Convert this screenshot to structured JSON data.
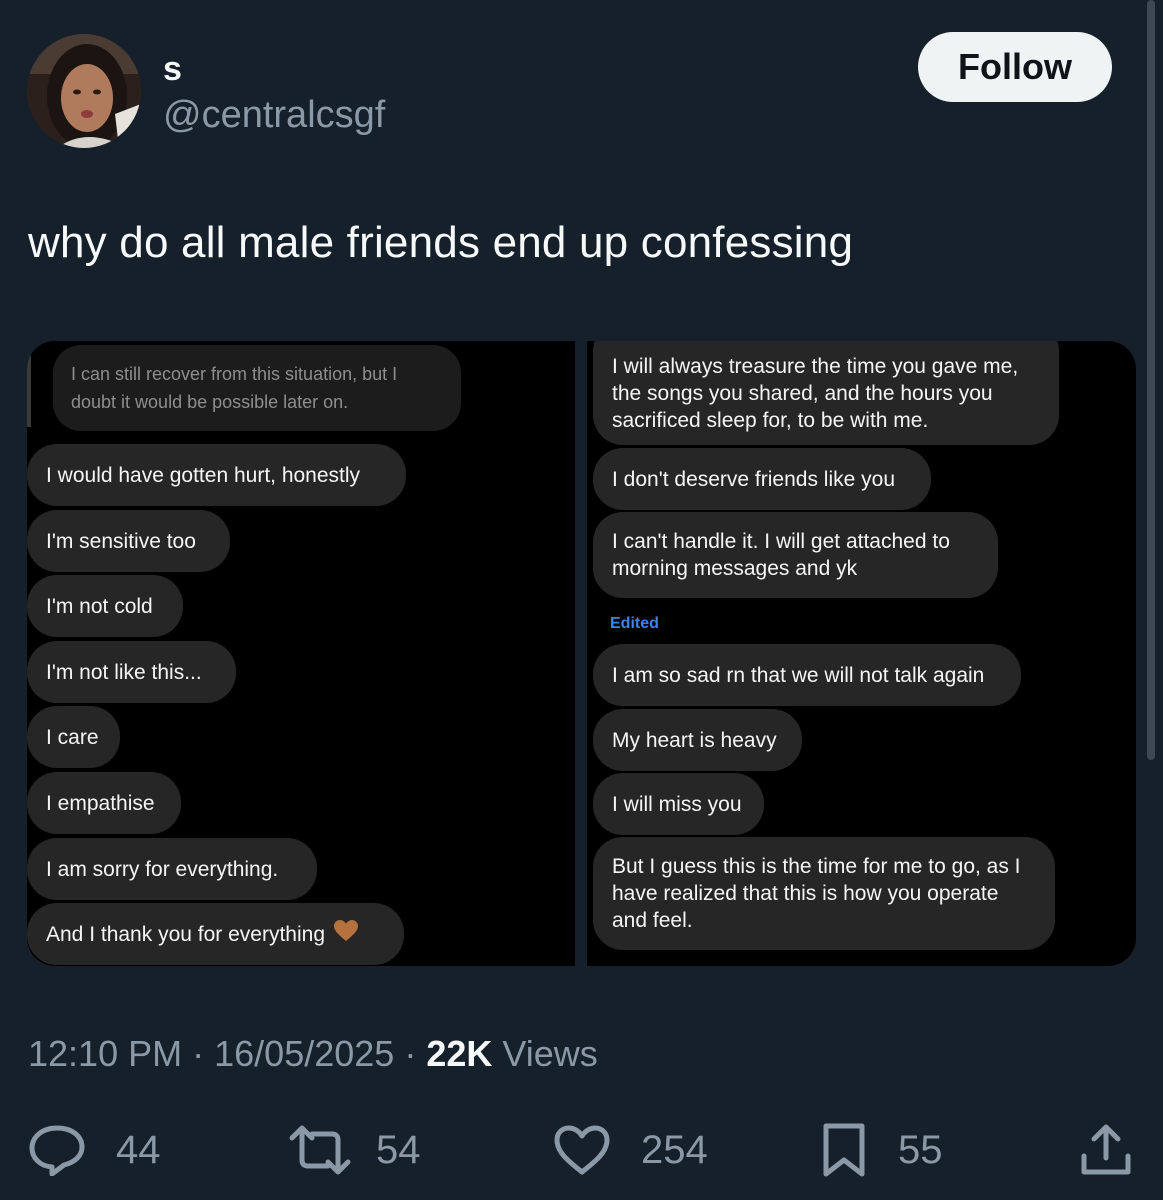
{
  "author": {
    "display_name": "s",
    "handle": "@centralcsgf"
  },
  "follow_label": "Follow",
  "tweet_text": "why do all male friends end up confessing",
  "media": {
    "left_panel": {
      "reply_quote": "I can still recover from this situation, but I doubt it would be possible later on.",
      "messages": [
        "I would have gotten hurt, honestly",
        "I'm sensitive too",
        "I'm not cold",
        "I'm not like this...",
        "I care",
        "I empathise",
        "I am sorry for everything.",
        "And I thank you for everything"
      ],
      "last_emoji": "brown-heart-icon"
    },
    "right_panel": {
      "messages": [
        "I will always treasure the time you gave me, the songs you shared, and the hours you sacrificed sleep for, to be with me.",
        "I don't deserve friends like you",
        "I can't handle it. I will get attached to morning messages and yk",
        "I am so sad rn that we will not talk again",
        "My heart is heavy",
        "I will miss you",
        "But I guess this is the time for me to go, as I have realized that this is how you operate and feel."
      ],
      "edited_label": "Edited"
    }
  },
  "meta": {
    "time": "12:10 PM",
    "separator": "·",
    "date": "16/05/2025",
    "views_count": "22K",
    "views_label": "Views"
  },
  "actions": {
    "replies": "44",
    "reposts": "54",
    "likes": "254",
    "bookmarks": "55"
  },
  "colors": {
    "background": "#15202b",
    "muted_text": "#8b98a5",
    "bubble": "#262626",
    "edited": "#3b82f6"
  }
}
